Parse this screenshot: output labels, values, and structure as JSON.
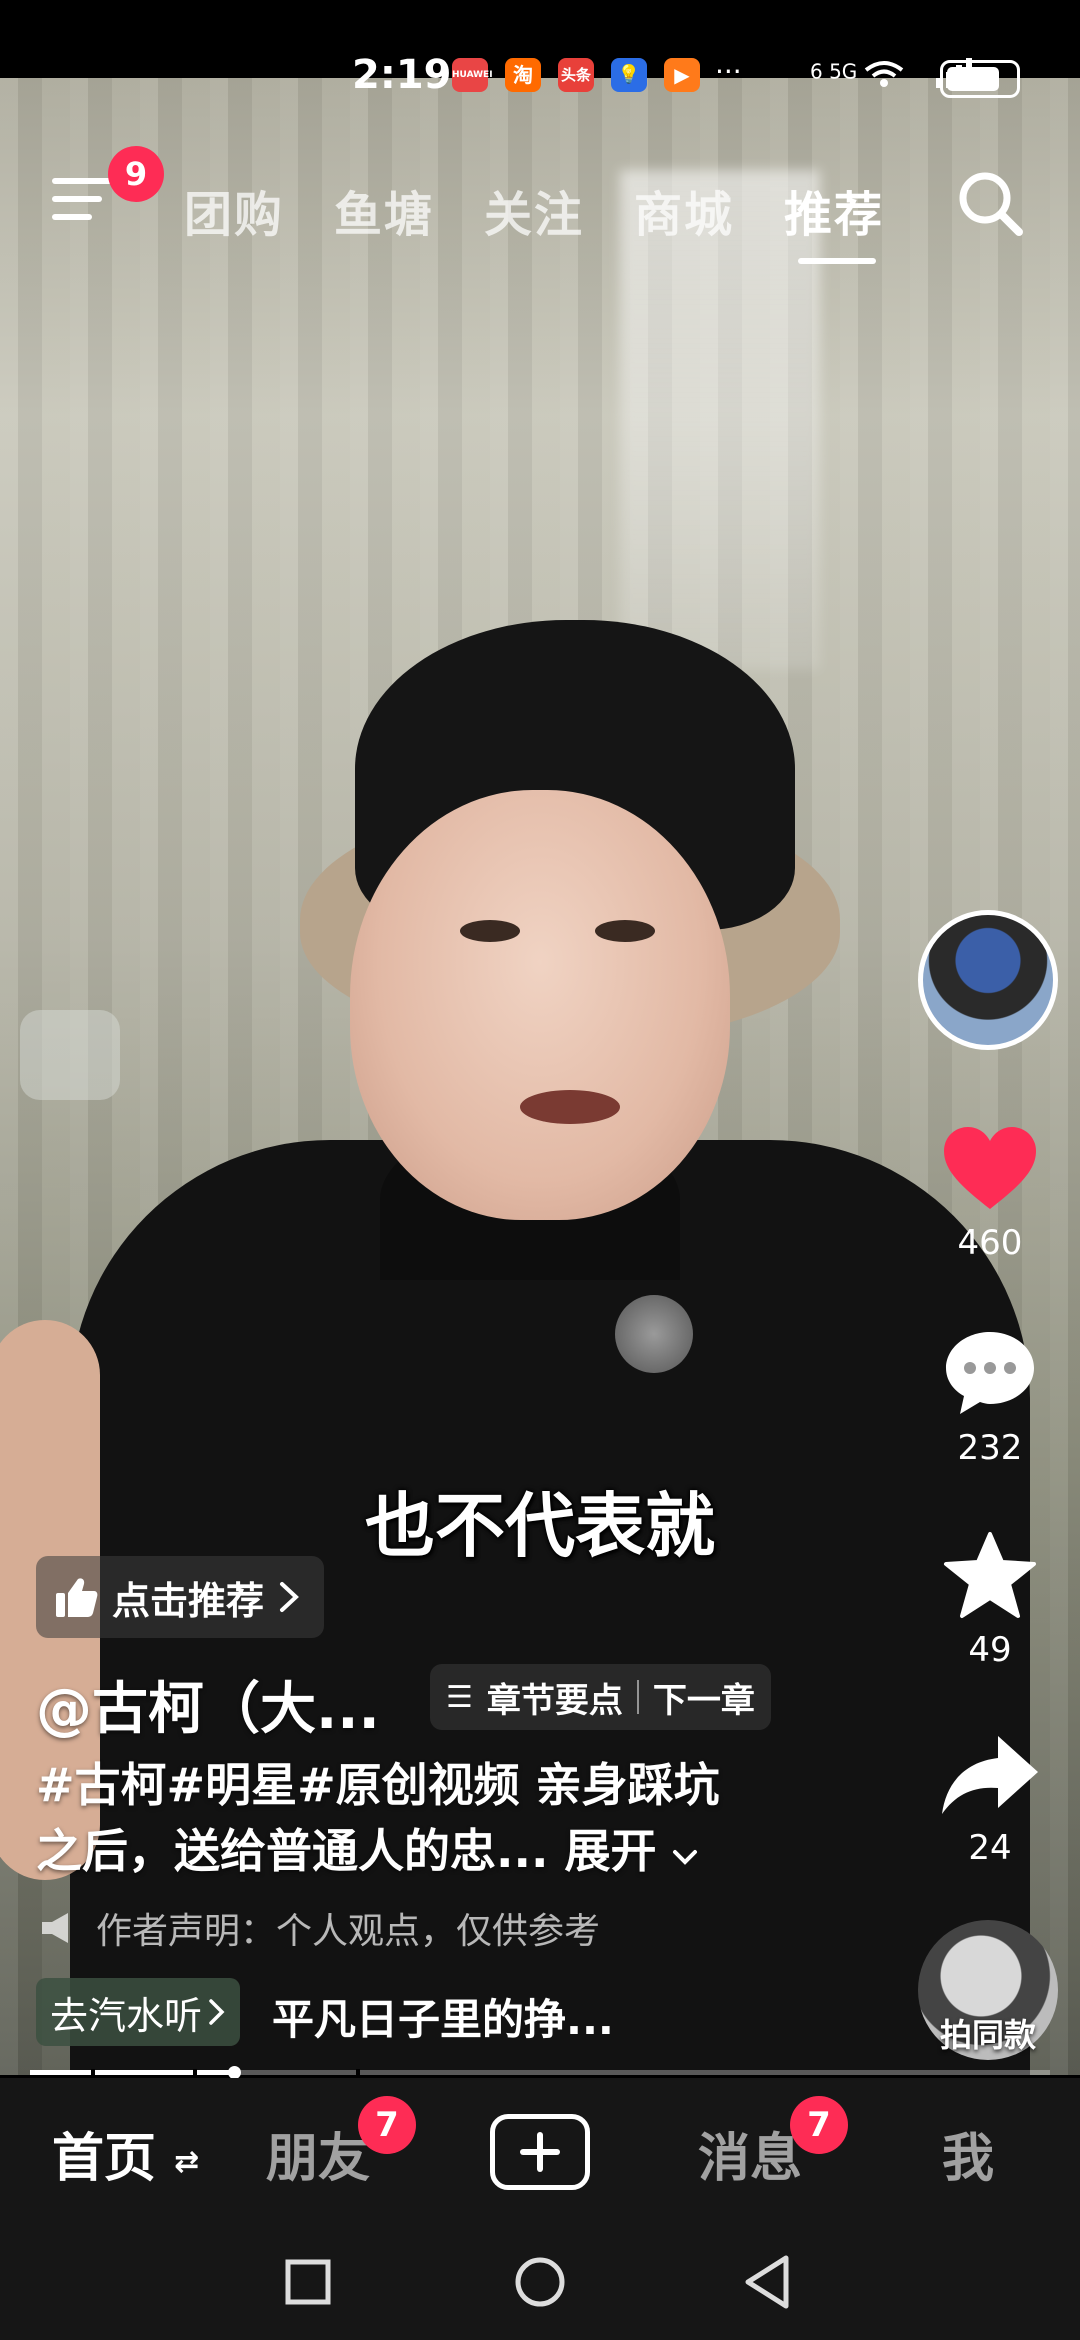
{
  "status_bar": {
    "time": "2:19",
    "apps": [
      {
        "icon": "huawei-app-icon",
        "label": "HUAWEI",
        "color": "#e94545"
      },
      {
        "icon": "taobao-app-icon",
        "label": "淘",
        "color": "#ff6a00"
      },
      {
        "icon": "toutiao-app-icon",
        "label": "头条",
        "color": "#e8403a"
      },
      {
        "icon": "bulb-app-icon",
        "label": "💡",
        "color": "#2b6de6"
      },
      {
        "icon": "play-app-icon",
        "label": "▶",
        "color": "#ff7a1a"
      }
    ],
    "more": "···",
    "network": "6 5G"
  },
  "top_nav": {
    "menu_badge": "9",
    "tabs": [
      "团购",
      "鱼塘",
      "关注",
      "商城",
      "推荐"
    ],
    "active_tab": "推荐"
  },
  "video": {
    "subtitle": "也不代表就"
  },
  "right_rail": {
    "likes": "460",
    "comments": "232",
    "favorites": "49",
    "shares": "24",
    "remix_label": "拍同款",
    "like_color": "#fe2c55"
  },
  "info": {
    "recommend_label": "点击推荐",
    "author": "@古柯（大...",
    "chapter_label": "章节要点",
    "next_chapter": "下一章",
    "caption_line1": "#古柯#明星#原创视频 亲身踩坑",
    "caption_line2": "之后，送给普通人的忠...",
    "expand_label": "展开",
    "disclaimer": "作者声明：个人观点，仅供参考",
    "music_tag": "去汽水听",
    "music_title": "平凡日子里的挣..."
  },
  "progress": {
    "fraction": 0.2,
    "chapter_marks": [
      0.06,
      0.16,
      0.32
    ]
  },
  "bottom_nav": {
    "home": "首页",
    "friends": "朋友",
    "friends_badge": "7",
    "messages": "消息",
    "messages_badge": "7",
    "me": "我"
  }
}
